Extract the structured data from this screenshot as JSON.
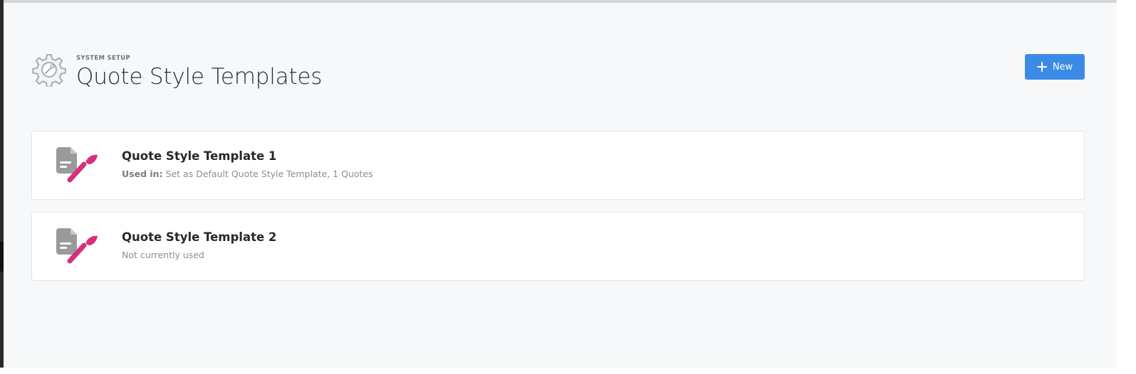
{
  "header": {
    "eyebrow": "SYSTEM SETUP",
    "title": "Quote Style Templates",
    "icon": "gear-wrench-icon"
  },
  "toolbar": {
    "new_label": "New",
    "new_icon": "plus-icon",
    "accent_color": "#3b8be6"
  },
  "templates": [
    {
      "name": "Quote Style Template 1",
      "usage_label": "Used in:",
      "usage_text": " Set as Default Quote Style Template, 1 Quotes",
      "icon": "document-paintbrush-icon"
    },
    {
      "name": "Quote Style Template 2",
      "usage_label": "",
      "usage_text": "Not currently used",
      "icon": "document-paintbrush-icon"
    }
  ],
  "colors": {
    "brush": "#d6307a",
    "document": "#9a9a9a",
    "background": "#f7f8f9"
  }
}
